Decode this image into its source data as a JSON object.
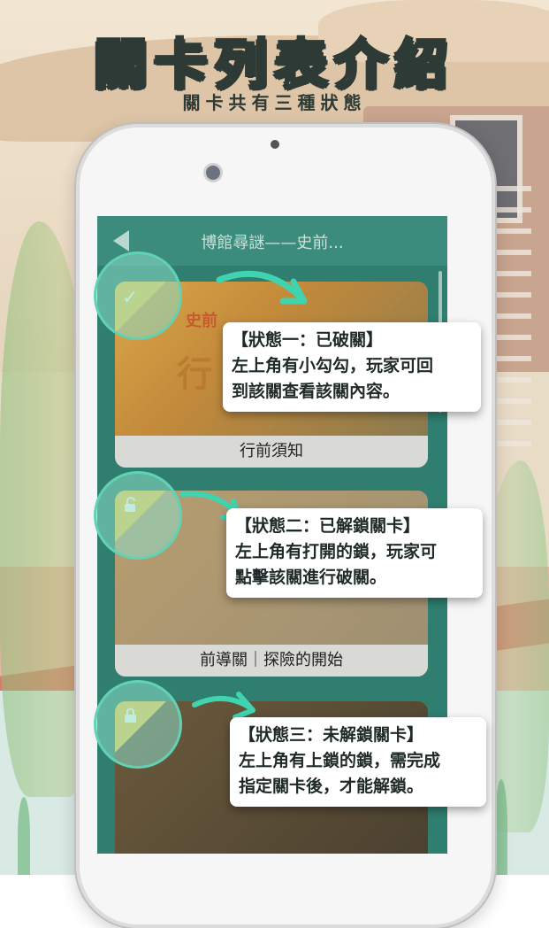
{
  "header": {
    "title": "關卡列表介紹",
    "subtitle": "關卡共有三種狀態"
  },
  "app": {
    "nav_title": "博館尋謎——史前...",
    "poster_text": "史前",
    "poster_char": "行"
  },
  "cards": [
    {
      "label": "行前須知",
      "state": "completed",
      "icon": "check-icon"
    },
    {
      "label": "前導關｜探險的開始",
      "state": "unlocked",
      "icon": "unlock-icon"
    },
    {
      "label": "",
      "state": "locked",
      "icon": "lock-icon"
    }
  ],
  "callouts": [
    {
      "title": "【狀態一：已破關】",
      "line1": "左上角有小勾勾，玩家可回",
      "line2": "到該關查看該關內容。"
    },
    {
      "title": "【狀態二：已解鎖關卡】",
      "line1": "左上角有打開的鎖，玩家可",
      "line2": "點擊該關進行破關。"
    },
    {
      "title": "【狀態三：未解鎖關卡】",
      "line1": "左上角有上鎖的鎖，需完成",
      "line2": "指定關卡後，才能解鎖。"
    }
  ],
  "colors": {
    "accent_teal": "#62d2b4",
    "corner_yellow": "#f1c84b",
    "screen_green": "#2f7e70"
  }
}
